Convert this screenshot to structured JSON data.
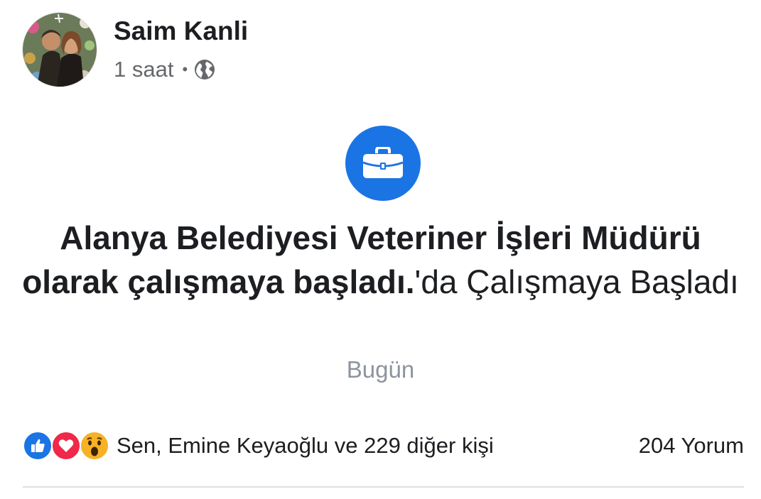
{
  "post": {
    "author_name": "Saim Kanli",
    "time": "1 saat",
    "separator": "•",
    "privacy_icon": "globe-icon",
    "avatar_icon": "profile-photo"
  },
  "event": {
    "icon": "briefcase-icon",
    "icon_bg_color": "#1b74e4",
    "title_strong_line1": "Alanya Belediyesi Veteriner İşleri Müdürü",
    "title_strong_line2": "olarak çalışmaya başladı.",
    "title_suffix": "'da Çalışmaya Başladı",
    "date": "Bugün"
  },
  "reactions": {
    "icons": [
      "like-icon",
      "love-icon",
      "wow-icon"
    ],
    "names": "Sen, Emine Keyaoğlu ve 229 diğer kişi",
    "comments": "204 Yorum"
  }
}
